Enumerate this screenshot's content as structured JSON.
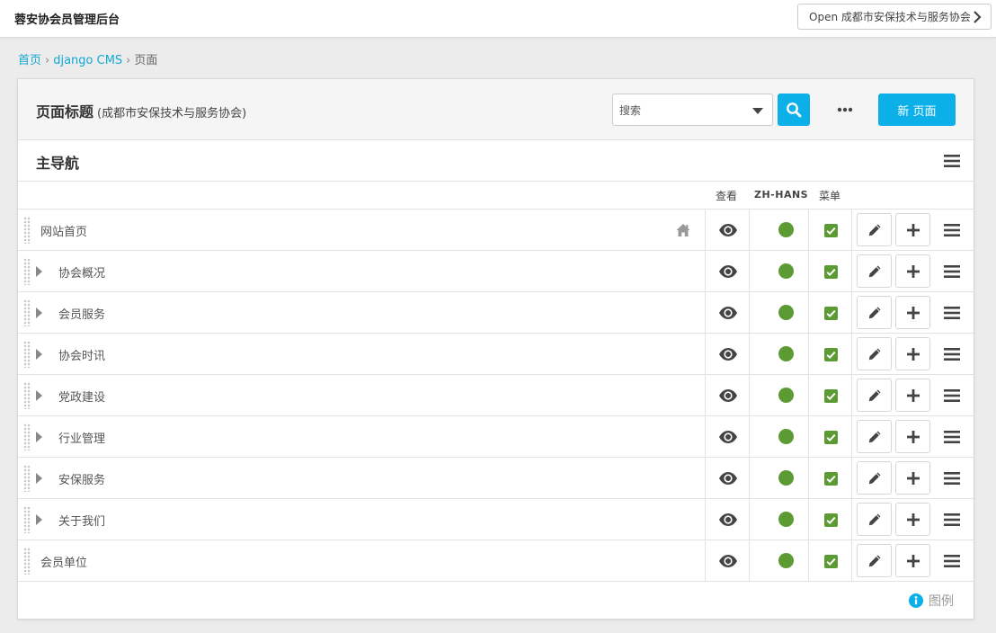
{
  "header": {
    "site_title": "蓉安协会员管理后台",
    "open_site_label": "Open 成都市安保技术与服务协会"
  },
  "breadcrumb": {
    "home": "首页",
    "django_cms": "django CMS",
    "current": "页面",
    "separator": "›"
  },
  "toolbar": {
    "title": "页面标题",
    "subtitle": "(成都市安保技术与服务协会)",
    "search_placeholder": "搜索",
    "more_label": "•••",
    "new_page_label": "新 页面"
  },
  "tree": {
    "title": "主导航",
    "columns": {
      "view": "查看",
      "language": "ZH-HANS",
      "menu": "菜单"
    },
    "rows": [
      {
        "label": "网站首页",
        "has_children": false,
        "is_home": true
      },
      {
        "label": "协会概况",
        "has_children": true,
        "is_home": false
      },
      {
        "label": "会员服务",
        "has_children": true,
        "is_home": false
      },
      {
        "label": "协会时讯",
        "has_children": true,
        "is_home": false
      },
      {
        "label": "党政建设",
        "has_children": true,
        "is_home": false
      },
      {
        "label": "行业管理",
        "has_children": true,
        "is_home": false
      },
      {
        "label": "安保服务",
        "has_children": true,
        "is_home": false
      },
      {
        "label": "关于我们",
        "has_children": true,
        "is_home": false
      },
      {
        "label": "会员单位",
        "has_children": false,
        "is_home": false
      }
    ]
  },
  "legend": {
    "label": "图例"
  },
  "colors": {
    "accent": "#0bb0e8",
    "link": "#11a8d4",
    "published": "#5c9b33",
    "icon": "#444444"
  },
  "icons": {
    "chevron": "chevron-right-icon",
    "search": "search-icon",
    "more": "more-dots-icon",
    "menu": "hamburger-menu-icon",
    "drag": "drag-handle-icon",
    "expand": "expand-triangle-icon",
    "home": "home-icon",
    "view": "eye-icon",
    "status": "published-dot-icon",
    "in_menu": "checkbox-checked-icon",
    "edit": "pencil-icon",
    "add": "plus-icon",
    "info": "info-icon"
  }
}
